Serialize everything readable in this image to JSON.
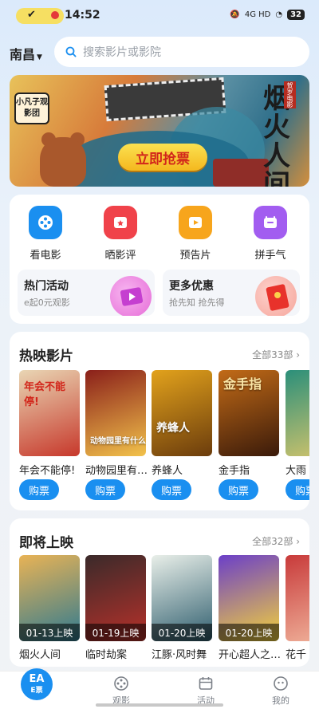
{
  "status": {
    "time": "14:52",
    "network": "4G HD",
    "battery": "32"
  },
  "header": {
    "city": "南昌",
    "search_placeholder": "搜索影片或影院"
  },
  "banner": {
    "cta_label": "立即抢票",
    "logo_text": "小凡子观影团",
    "title_art": "烟火人间",
    "title_tag": "贺岁电影"
  },
  "quick_menu": [
    {
      "label": "看电影",
      "icon": "film-reel-icon",
      "color": "#1a8ff0"
    },
    {
      "label": "晒影评",
      "icon": "review-icon",
      "color": "#f0424a"
    },
    {
      "label": "预告片",
      "icon": "play-icon",
      "color": "#f7a51c"
    },
    {
      "label": "拼手气",
      "icon": "gift-icon",
      "color": "#a25df0"
    }
  ],
  "promos": [
    {
      "title": "热门活动",
      "subtitle": "e起0元观影",
      "icon": "play-ticket-icon"
    },
    {
      "title": "更多优惠",
      "subtitle": "抢先知 抢先得",
      "icon": "red-envelope-icon"
    }
  ],
  "now_showing": {
    "title": "热映影片",
    "more": "全部33部 ›",
    "movies": [
      {
        "name": "年会不能停!",
        "poster_text": "年会不能停!",
        "colors": [
          "#e9d6b4",
          "#c7382b"
        ]
      },
      {
        "name": "动物园里有…",
        "poster_text": "动物园里有什么",
        "colors": [
          "#8a1f1a",
          "#f2c24b"
        ]
      },
      {
        "name": "养蜂人",
        "poster_text": "养蜂人",
        "colors": [
          "#e2a21c",
          "#6b3c0c"
        ]
      },
      {
        "name": "金手指",
        "poster_text": "金手指",
        "colors": [
          "#c26b17",
          "#3a1a0a"
        ]
      },
      {
        "name": "大雨",
        "poster_text": "",
        "colors": [
          "#2b8f7a",
          "#d9c66b"
        ]
      }
    ],
    "buy_label": "购票"
  },
  "coming_soon": {
    "title": "即将上映",
    "more": "全部32部 ›",
    "movies": [
      {
        "name": "烟火人间",
        "date": "01-13上映",
        "colors": [
          "#e9b355",
          "#2f7a90"
        ]
      },
      {
        "name": "临时劫案",
        "date": "01-19上映",
        "colors": [
          "#3a2a2a",
          "#b8312a"
        ]
      },
      {
        "name": "江豚·风时舞",
        "date": "01-20上映",
        "colors": [
          "#e9efe9",
          "#2f5e6e"
        ]
      },
      {
        "name": "开心超人之…",
        "date": "01-20上映",
        "colors": [
          "#6b3fc9",
          "#f4d23a"
        ]
      },
      {
        "name": "花千",
        "date": "",
        "colors": [
          "#c83a3a",
          "#f2b9a0"
        ]
      }
    ]
  },
  "bottom_nav": [
    {
      "label": "E票",
      "icon": "e-ticket-icon"
    },
    {
      "label": "观影",
      "icon": "film-reel-icon"
    },
    {
      "label": "活动",
      "icon": "calendar-icon"
    },
    {
      "label": "我的",
      "icon": "profile-icon"
    }
  ]
}
